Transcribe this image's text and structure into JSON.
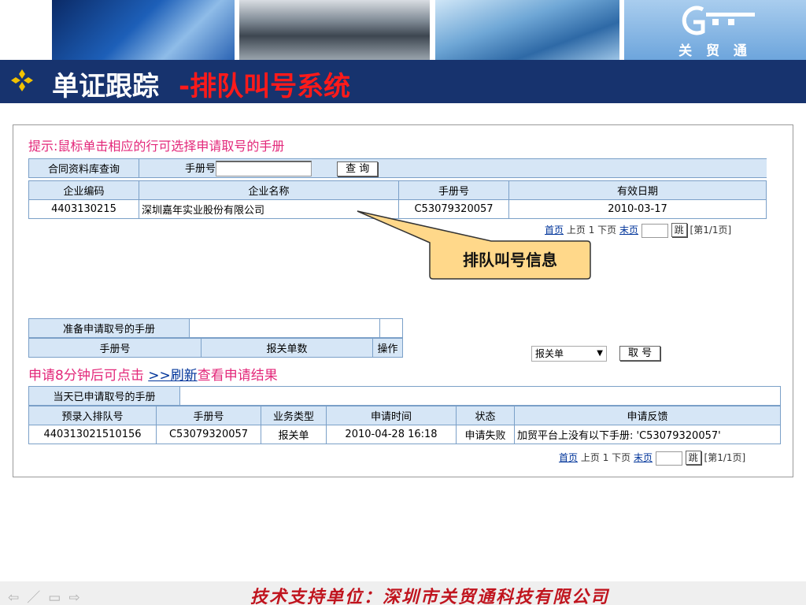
{
  "header": {
    "logo_text": "关 贸 通"
  },
  "title": {
    "main": "单证跟踪",
    "sub": "-排队叫号系统"
  },
  "tip": "提示:鼠标单击相应的行可选择申请取号的手册",
  "search": {
    "db_label": "合同资料库查询",
    "field_label": "手册号",
    "button": "查 询"
  },
  "contract_table": {
    "headers": [
      "企业编码",
      "企业名称",
      "手册号",
      "有效日期"
    ],
    "rows": [
      [
        "4403130215",
        "深圳嘉年实业股份有限公司",
        "C53079320057",
        "2010-03-17"
      ]
    ]
  },
  "pager": {
    "first": "首页",
    "prev": "上页",
    "page_num": "1",
    "next": "下页",
    "last": "末页",
    "jump": "跳",
    "info": "[第1/1页]"
  },
  "callout": "排队叫号信息",
  "prepare": {
    "title": "准备申请取号的手册",
    "headers": [
      "手册号",
      "报关单数",
      "操作"
    ]
  },
  "select": {
    "value": "报关单"
  },
  "take_button": "取 号",
  "refresh": {
    "prefix": "申请8分钟后可点击",
    "link": ">>刷新",
    "suffix": "查看申请结果"
  },
  "today": {
    "title": "当天已申请取号的手册",
    "headers": [
      "预录入排队号",
      "手册号",
      "业务类型",
      "申请时间",
      "状态",
      "申请反馈"
    ],
    "rows": [
      [
        "440313021510156",
        "C53079320057",
        "报关单",
        "2010-04-28 16:18",
        "申请失败",
        "加贸平台上没有以下手册: 'C53079320057'"
      ]
    ]
  },
  "footer": {
    "nav": [
      "⇦",
      "／",
      "▭",
      "⇨"
    ],
    "text": "技术支持单位：深圳市关贸通科技有限公司"
  },
  "colors": {
    "title_bg": "#17336e",
    "tip": "#e3287a",
    "title_sub": "#ff1a1a",
    "header_cell": "#d6e6f6",
    "callout_fill": "#ffd88a",
    "footer_text": "#c0141e"
  }
}
